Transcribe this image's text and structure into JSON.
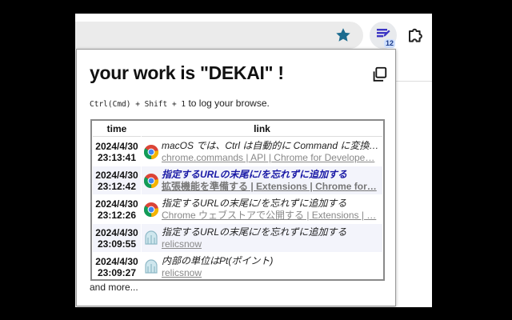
{
  "colors": {
    "star": "#1b6b8f",
    "badge_bg": "#cfe0ff",
    "title_link": "#1a1aa6",
    "url": "#888888"
  },
  "toolbar": {
    "star_icon": "star-icon",
    "extension_icon": "dekai-extension-icon",
    "extension_badge": "12",
    "puzzle_icon": "extensions-puzzle-icon"
  },
  "popup": {
    "title": "your work is \"DEKAI\" !",
    "copy_icon": "copy-icon",
    "hint_shortcut": "Ctrl(Cmd) + Shift + 1",
    "hint_text": " to log your browse.",
    "columns": [
      "time",
      "link"
    ],
    "rows": [
      {
        "date": "2024/4/30",
        "clock": "23:13:41",
        "icon": "chrome-icon",
        "title": "macOS では、Ctrl は自動的に Command に変換さ…",
        "url": "chrome.commands | API | Chrome for Develope…",
        "title_link": false,
        "url_bold": false
      },
      {
        "date": "2024/4/30",
        "clock": "23:12:42",
        "icon": "chrome-icon",
        "title": "指定するURLの末尾に/を忘れずに追加する",
        "url": "拡張機能を準備する | Extensions | Chrome for…",
        "title_link": true,
        "url_bold": true
      },
      {
        "date": "2024/4/30",
        "clock": "23:12:26",
        "icon": "chrome-icon",
        "title": "指定するURLの末尾に/を忘れずに追加する",
        "url": "Chrome ウェブストアで公開する | Extensions | …",
        "title_link": false,
        "url_bold": false
      },
      {
        "date": "2024/4/30",
        "clock": "23:09:55",
        "icon": "relicsnow-icon",
        "title": "指定するURLの末尾に/を忘れずに追加する",
        "url": "relicsnow",
        "title_link": false,
        "url_bold": false
      },
      {
        "date": "2024/4/30",
        "clock": "23:09:27",
        "icon": "relicsnow-icon",
        "title": "内部の単位はPt(ポイント)",
        "url": "relicsnow",
        "title_link": false,
        "url_bold": false
      }
    ],
    "more": "and more..."
  }
}
